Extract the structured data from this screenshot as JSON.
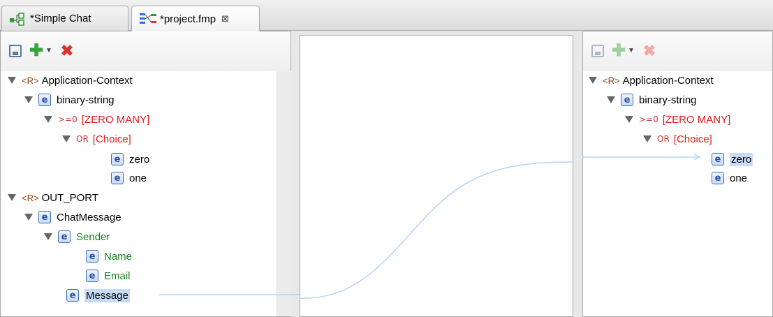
{
  "tabs": [
    {
      "label": "*Simple Chat",
      "icon": "graph-icon"
    },
    {
      "label": "*project.fmp",
      "icon": "mapping-icon",
      "close": "⊠"
    }
  ],
  "left_tree": {
    "ctx_tag": "<R>",
    "ctx": "Application-Context",
    "binary_string": "binary-string",
    "zero_many_sym": ">=0",
    "zero_many": "[ZERO MANY]",
    "or_sym": "OR",
    "choice": "[Choice]",
    "zero": "zero",
    "one": "one",
    "out_tag": "<R>",
    "out_port": "OUT_PORT",
    "chat_message": "ChatMessage",
    "sender": "Sender",
    "name": "Name",
    "email": "Email",
    "message": "Message"
  },
  "right_tree": {
    "ctx_tag": "<R>",
    "ctx": "Application-Context",
    "binary_string": "binary-string",
    "zero_many_sym": ">=0",
    "zero_many": "[ZERO MANY]",
    "or_sym": "OR",
    "choice": "[Choice]",
    "zero": "zero",
    "one": "one"
  },
  "mapping": {
    "from": "Message",
    "to": "zero"
  },
  "colors": {
    "link": "#b6d3f5",
    "selection": "#c7dbf7",
    "required": "#e31b1b",
    "optional": "#1b7f1b"
  }
}
